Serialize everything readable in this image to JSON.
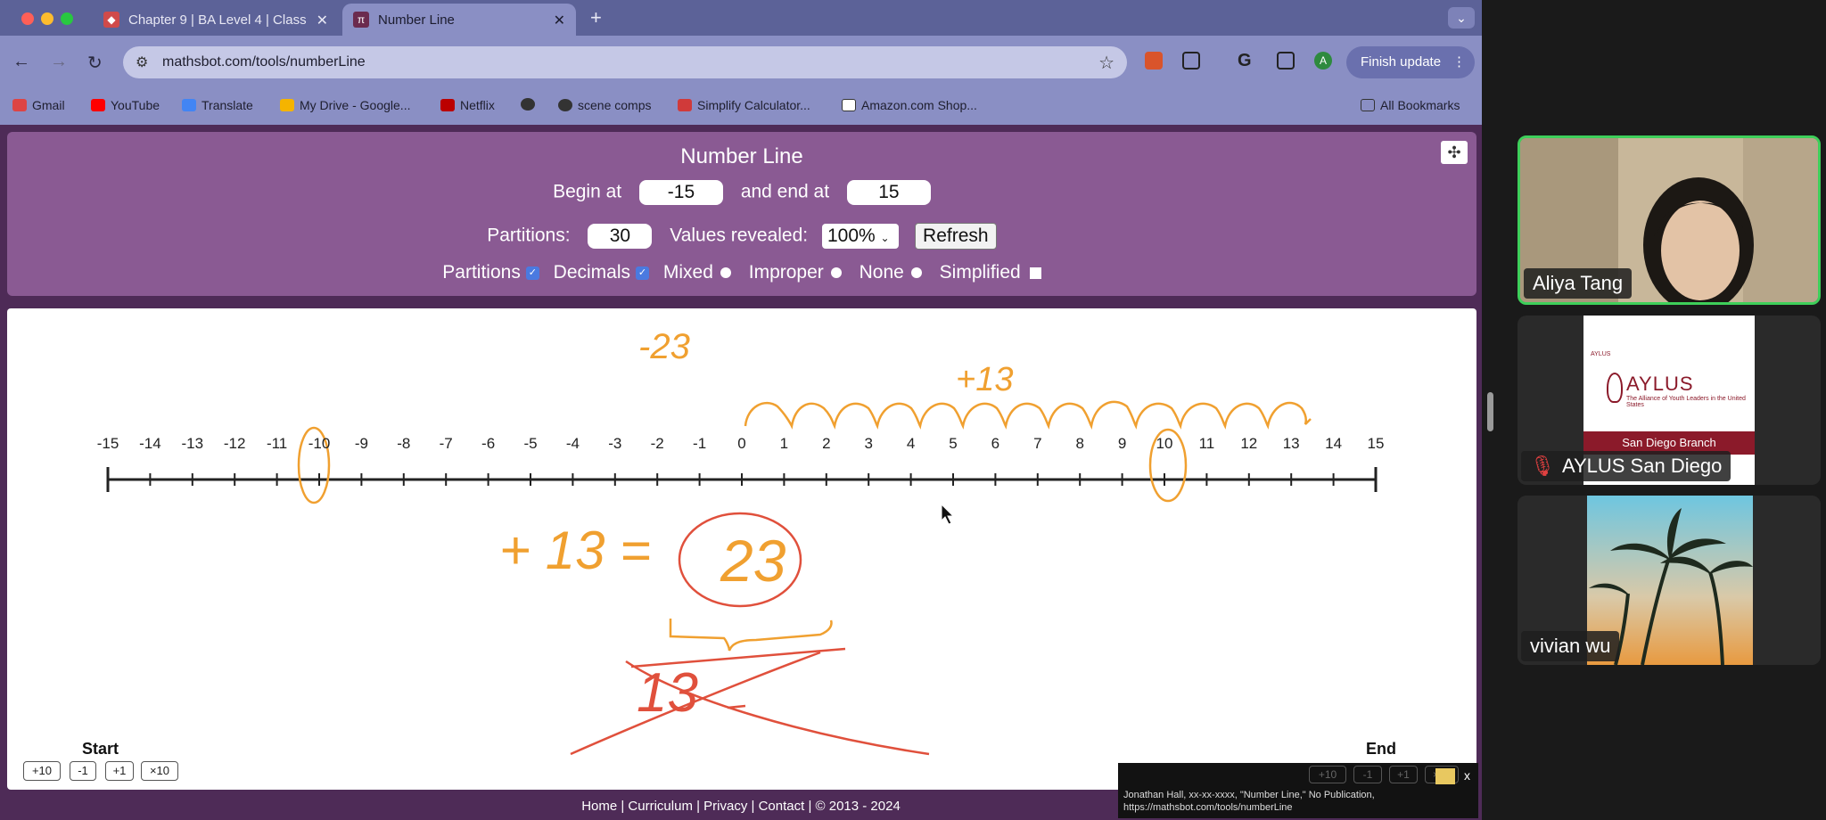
{
  "tabs": [
    {
      "title": "Chapter 9 | BA Level 4 | Class",
      "active": false
    },
    {
      "title": "Number Line",
      "active": true
    }
  ],
  "address": {
    "url": "mathsbot.com/tools/numberLine"
  },
  "finish_update": "Finish update",
  "bookmarks": [
    "Gmail",
    "YouTube",
    "Translate",
    "My Drive - Google...",
    "Netflix",
    "scene comps",
    "Simplify Calculator...",
    "Amazon.com Shop..."
  ],
  "all_bookmarks": "All Bookmarks",
  "tool": {
    "title": "Number Line",
    "begin_label": "Begin at",
    "begin_value": "-15",
    "end_label": "and end at",
    "end_value": "15",
    "partitions_label": "Partitions:",
    "partitions_value": "30",
    "values_revealed_label": "Values revealed:",
    "values_revealed_value": "100%",
    "refresh_label": "Refresh",
    "options": {
      "partitions": "Partitions",
      "decimals": "Decimals",
      "mixed": "Mixed",
      "improper": "Improper",
      "none": "None",
      "simplified": "Simplified"
    }
  },
  "number_line": {
    "ticks": [
      "-15",
      "-14",
      "-13",
      "-12",
      "-11",
      "-10",
      "-9",
      "-8",
      "-7",
      "-6",
      "-5",
      "-4",
      "-3",
      "-2",
      "-1",
      "0",
      "1",
      "2",
      "3",
      "4",
      "5",
      "6",
      "7",
      "8",
      "9",
      "10",
      "11",
      "12",
      "13",
      "14",
      "15"
    ],
    "start_label": "Start",
    "end_label": "End",
    "start_buttons": [
      "+10",
      "-1",
      "+1",
      "×10"
    ],
    "end_buttons": [
      "+10",
      "-1",
      "+1",
      "×10"
    ]
  },
  "annotations": {
    "top_note": "-23",
    "hop_label": "+13",
    "equation_left": "+ 13 =",
    "equation_right": "23",
    "crossed": "13"
  },
  "footer": "Home | Curriculum | Privacy | Contact | © 2013 - 2024",
  "citation": {
    "line1": "Jonathan Hall, xx-xx-xxxx, \"Number Line,\" No Publication,",
    "line2": "https://mathsbot.com/tools/numberLine",
    "close": "x"
  },
  "participants": [
    {
      "name": "Aliya Tang",
      "speaking": true
    },
    {
      "name": "AYLUS San Diego",
      "muted": true
    },
    {
      "name": "vivian wu"
    }
  ],
  "aylus_logo": {
    "name": "AYLUS",
    "tagline": "The Alliance of Youth Leaders in the United States",
    "branch": "San Diego Branch"
  }
}
